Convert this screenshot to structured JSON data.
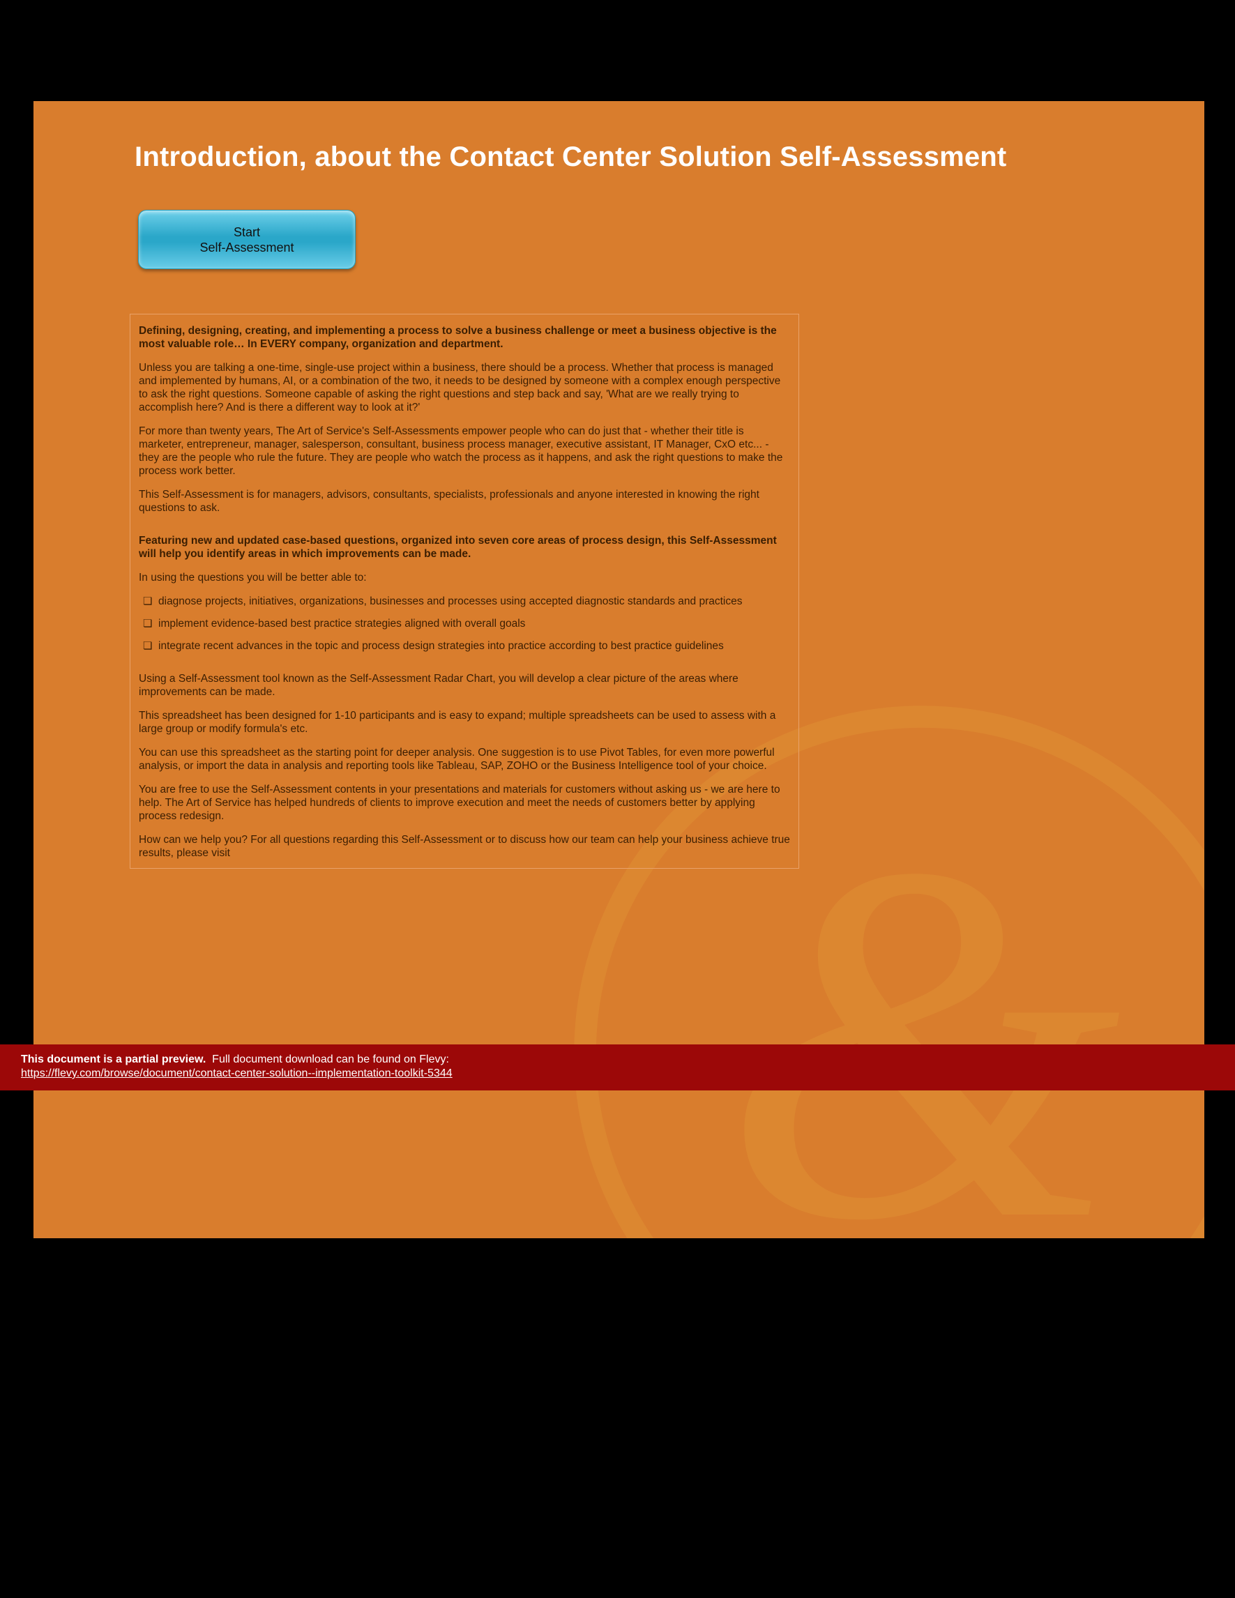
{
  "title": "Introduction, about the Contact Center Solution Self-Assessment",
  "button": {
    "line1": "Start",
    "line2": "Self-Assessment"
  },
  "content": {
    "lead": "Defining, designing, creating, and implementing a process to solve a business challenge or meet a business objective is the most valuable role… In EVERY company, organization and department.",
    "p1": "Unless you are talking a one-time, single-use project within a business, there should be a process. Whether that process is managed and implemented by humans, AI, or a combination of the two, it needs to be designed by someone with a complex enough perspective to ask the right questions. Someone capable of asking the right questions and step back and say, 'What are we really trying to accomplish here? And is there a different way to look at it?'",
    "p2": "For more than twenty years, The Art of Service's Self-Assessments empower people who can do just that - whether their title is marketer, entrepreneur, manager, salesperson, consultant, business process manager, executive assistant, IT Manager, CxO etc... - they are the people who rule the future. They are people who watch the process as it happens, and ask the right questions to make the process work better.",
    "p3": "This Self-Assessment is for managers, advisors, consultants, specialists, professionals and anyone interested in knowing the right questions to ask.",
    "bold2": "Featuring new and updated case-based questions, organized into seven core areas of process design, this Self-Assessment will help you identify areas in which improvements can be made.",
    "p4": "In using the questions you will be better able to:",
    "bullets": [
      "diagnose projects, initiatives, organizations, businesses and processes using accepted diagnostic standards and practices",
      "implement evidence-based best practice strategies aligned with overall goals",
      "integrate recent advances in the topic and process design strategies into practice according to best practice guidelines"
    ],
    "p5": "Using a Self-Assessment tool known as the Self-Assessment Radar Chart, you will develop a clear picture of the areas where improvements can be made.",
    "p6": "This spreadsheet has been designed for 1-10 participants and is easy to expand; multiple spreadsheets can be used to assess with a large group or modify formula's etc.",
    "p7": "You can use this spreadsheet as the starting point for deeper analysis. One suggestion is to use Pivot Tables, for even more powerful analysis, or import the data in analysis and reporting tools like Tableau, SAP, ZOHO or the Business Intelligence tool of your choice.",
    "p8": "You are free to use the Self-Assessment contents in your presentations and materials for customers without asking us - we are here to help. The Art of Service has helped hundreds of clients to improve execution and meet the needs of customers better by applying process redesign.",
    "p9": "How can we help you? For all questions regarding this Self-Assessment or to discuss how our team can help your business achieve true results, please visit"
  },
  "banner": {
    "bold": "This document is a partial preview.",
    "rest": "Full document download can be found on Flevy:",
    "link": "https://flevy.com/browse/document/contact-center-solution--implementation-toolkit-5344"
  }
}
